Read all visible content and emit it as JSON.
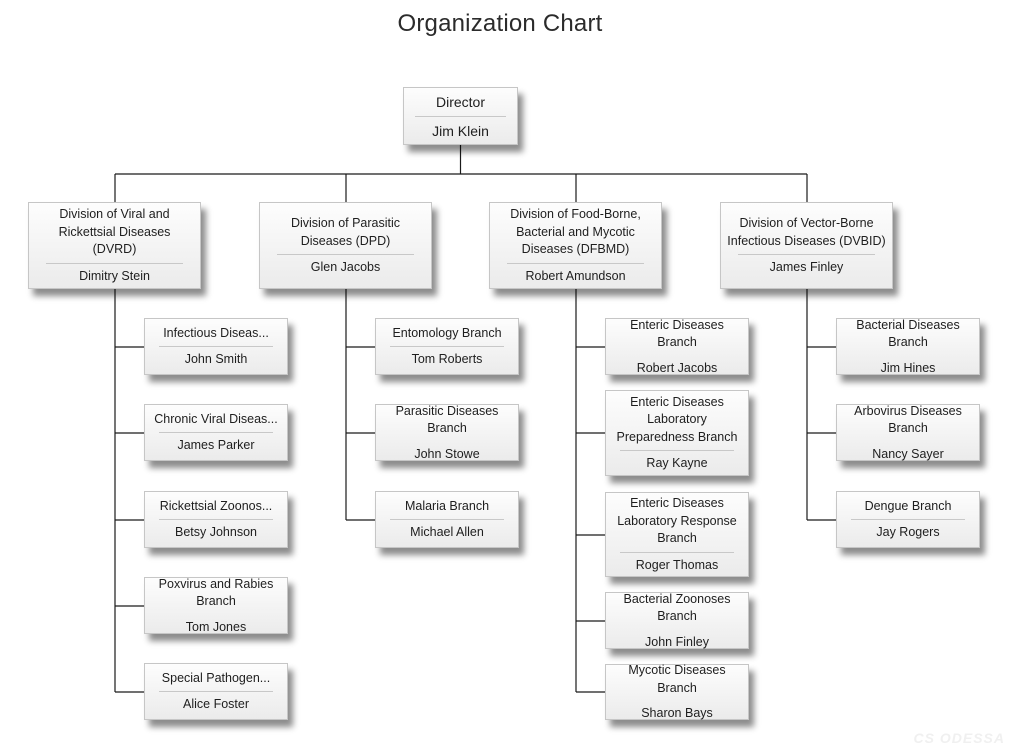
{
  "title": "Organization Chart",
  "watermark": "CS ODESSA",
  "director": {
    "role": "Director",
    "name": "Jim Klein"
  },
  "divisions": [
    {
      "role": "Division of Viral and Rickettsial Diseases (DVRD)",
      "name": "Dimitry Stein",
      "branches": [
        {
          "role": "Infectious Diseas...",
          "name": "John Smith"
        },
        {
          "role": "Chronic Viral Diseas...",
          "name": "James Parker"
        },
        {
          "role": "Rickettsial Zoonos...",
          "name": "Betsy Johnson"
        },
        {
          "role": "Poxvirus and Rabies Branch",
          "name": "Tom Jones"
        },
        {
          "role": "Special Pathogen...",
          "name": "Alice Foster"
        }
      ]
    },
    {
      "role": "Division of Parasitic Diseases (DPD)",
      "name": "Glen Jacobs",
      "branches": [
        {
          "role": "Entomology Branch",
          "name": "Tom Roberts"
        },
        {
          "role": "Parasitic Diseases Branch",
          "name": "John Stowe"
        },
        {
          "role": "Malaria Branch",
          "name": "Michael Allen"
        }
      ]
    },
    {
      "role": "Division of Food-Borne, Bacterial and Mycotic Diseases (DFBMD)",
      "name": "Robert Amundson",
      "branches": [
        {
          "role": "Enteric Diseases Branch",
          "name": "Robert Jacobs"
        },
        {
          "role": "Enteric Diseases Laboratory Preparedness Branch",
          "name": "Ray Kayne"
        },
        {
          "role": "Enteric Diseases Laboratory Response Branch",
          "name": "Roger Thomas"
        },
        {
          "role": "Bacterial Zoonoses Branch",
          "name": "John Finley"
        },
        {
          "role": "Mycotic Diseases Branch",
          "name": "Sharon Bays"
        }
      ]
    },
    {
      "role": "Division of Vector-Borne Infectious Diseases (DVBID)",
      "name": "James Finley",
      "branches": [
        {
          "role": "Bacterial Diseases Branch",
          "name": "Jim Hines"
        },
        {
          "role": "Arbovirus Diseases Branch",
          "name": "Nancy Sayer"
        },
        {
          "role": "Dengue Branch",
          "name": "Jay Rogers"
        }
      ]
    }
  ]
}
